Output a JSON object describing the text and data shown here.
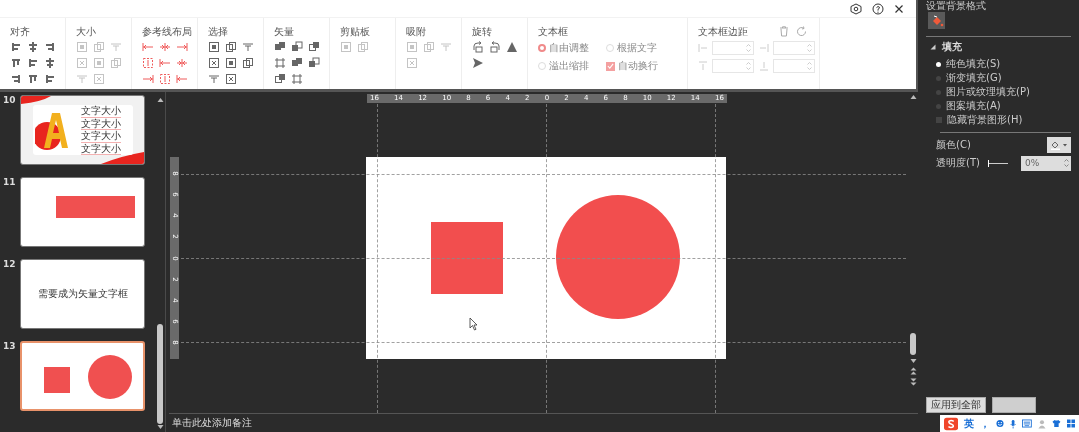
{
  "ribbon": {
    "groups": [
      {
        "kind": "icons",
        "title": "对齐",
        "disabled": false
      },
      {
        "kind": "icons",
        "title": "大小",
        "disabled": true
      },
      {
        "kind": "icons",
        "title": "参考线布局",
        "disabled": false
      },
      {
        "kind": "icons",
        "title": "选择",
        "disabled": false
      },
      {
        "kind": "icons",
        "title": "矢量",
        "disabled": false
      },
      {
        "kind": "icons",
        "title": "剪贴板",
        "disabled": true
      },
      {
        "kind": "icons",
        "title": "吸附",
        "disabled": true
      },
      {
        "kind": "icons",
        "title": "旋转",
        "disabled": false
      },
      {
        "kind": "textbox",
        "title": "文本框",
        "options": [
          {
            "kind": "radio",
            "label": "自由调整",
            "selected": true
          },
          {
            "kind": "radio",
            "label": "根据文字",
            "selected": false
          },
          {
            "kind": "radio",
            "label": "溢出缩排",
            "selected": false
          },
          {
            "kind": "checkbox",
            "label": "自动换行",
            "checked": true
          }
        ]
      },
      {
        "kind": "margins",
        "title": "文本框边距"
      }
    ]
  },
  "slides": [
    {
      "number": "10",
      "selected": false,
      "kind": "art",
      "texts": [
        "文字大小",
        "文字大小",
        "文字大小",
        "文字大小"
      ]
    },
    {
      "number": "11",
      "selected": false,
      "kind": "shapes"
    },
    {
      "number": "12",
      "selected": false,
      "kind": "text",
      "text": "需要成为矢量文字框"
    },
    {
      "number": "13",
      "selected": true,
      "kind": "shapes"
    }
  ],
  "editor": {
    "rulers": {
      "horizontal": [
        "16",
        "14",
        "12",
        "10",
        "8",
        "6",
        "4",
        "2",
        "0",
        "2",
        "4",
        "6",
        "8",
        "10",
        "12",
        "14",
        "16"
      ],
      "vertical": [
        "8",
        "6",
        "4",
        "2",
        "0",
        "2",
        "4",
        "6",
        "8"
      ]
    },
    "slide": {
      "shapes": [
        {
          "kind": "rect"
        },
        {
          "kind": "circle"
        }
      ]
    },
    "notes_placeholder": "单击此处添加备注"
  },
  "format_panel": {
    "title": "设置背景格式",
    "section": {
      "title": "填充",
      "expanded": true,
      "options": [
        {
          "kind": "radio",
          "label": "纯色填充(S)",
          "selected": true
        },
        {
          "kind": "radio",
          "label": "渐变填充(G)",
          "selected": false
        },
        {
          "kind": "radio",
          "label": "图片或纹理填充(P)",
          "selected": false
        },
        {
          "kind": "radio",
          "label": "图案填充(A)",
          "selected": false
        },
        {
          "kind": "checkbox",
          "label": "隐藏背景图形(H)",
          "checked": false
        }
      ]
    },
    "color_label": "颜色(C)",
    "transparency": {
      "label": "透明度(T)",
      "level": 0,
      "value": "0%"
    },
    "buttons": [
      {
        "label": "应用到全部",
        "disabled": false
      },
      {
        "disabled": true
      }
    ]
  },
  "ime_toolbar": {
    "mode": "英",
    "punctuation": "，"
  }
}
